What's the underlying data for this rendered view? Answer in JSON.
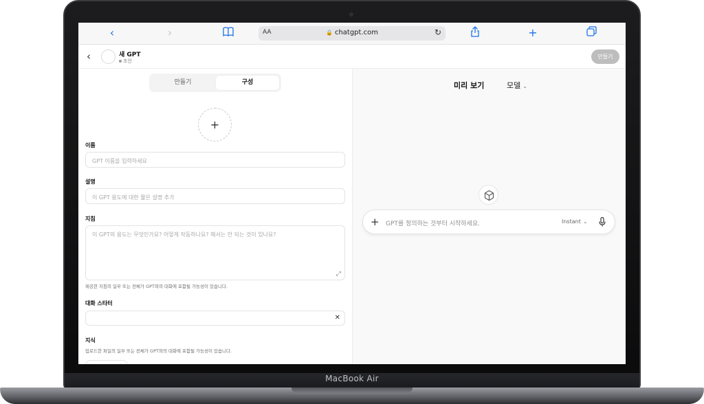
{
  "device_label": "MacBook Air",
  "safari": {
    "text_size": "AA",
    "url": "chatgpt.com",
    "icons": [
      "back-icon",
      "forward-icon",
      "bookmarks-icon",
      "lock-icon",
      "reload-icon",
      "share-icon",
      "new-tab-icon",
      "tabs-icon"
    ]
  },
  "header": {
    "gpt_name": "새 GPT",
    "status": "초안",
    "create_button": "만들기"
  },
  "tabs": [
    {
      "label": "만들기",
      "active": false
    },
    {
      "label": "구성",
      "active": true
    }
  ],
  "form": {
    "name_label": "이름",
    "name_placeholder": "GPT 이름을 입력하세요",
    "description_label": "설명",
    "description_placeholder": "이 GPT 용도에 대한 짧은 설명 추가",
    "instructions_label": "지침",
    "instructions_placeholder": "이 GPT의 용도는 무엇인가요? 어떻게 작동하나요? 해서는 안 되는 것이 있나요?",
    "instructions_note": "제공한 지침의 일부 또는 전체가 GPT와의 대화에 포함될 가능성이 있습니다.",
    "starters_label": "대화 스타터",
    "starters_value": "",
    "knowledge_label": "지식",
    "knowledge_note": "업로드한 파일의 일부 또는 전체가 GPT와의 대화에 포함될 가능성이 있습니다."
  },
  "preview": {
    "title": "미리 보기",
    "model": "모델",
    "composer_placeholder": "GPT를 정의하는 것부터 시작하세요.",
    "mode": "Instant"
  },
  "colors": {
    "safari_accent": "#1a73e8",
    "disabled_button": "#bdbdbd",
    "preview_bg": "#f9f9f9"
  }
}
